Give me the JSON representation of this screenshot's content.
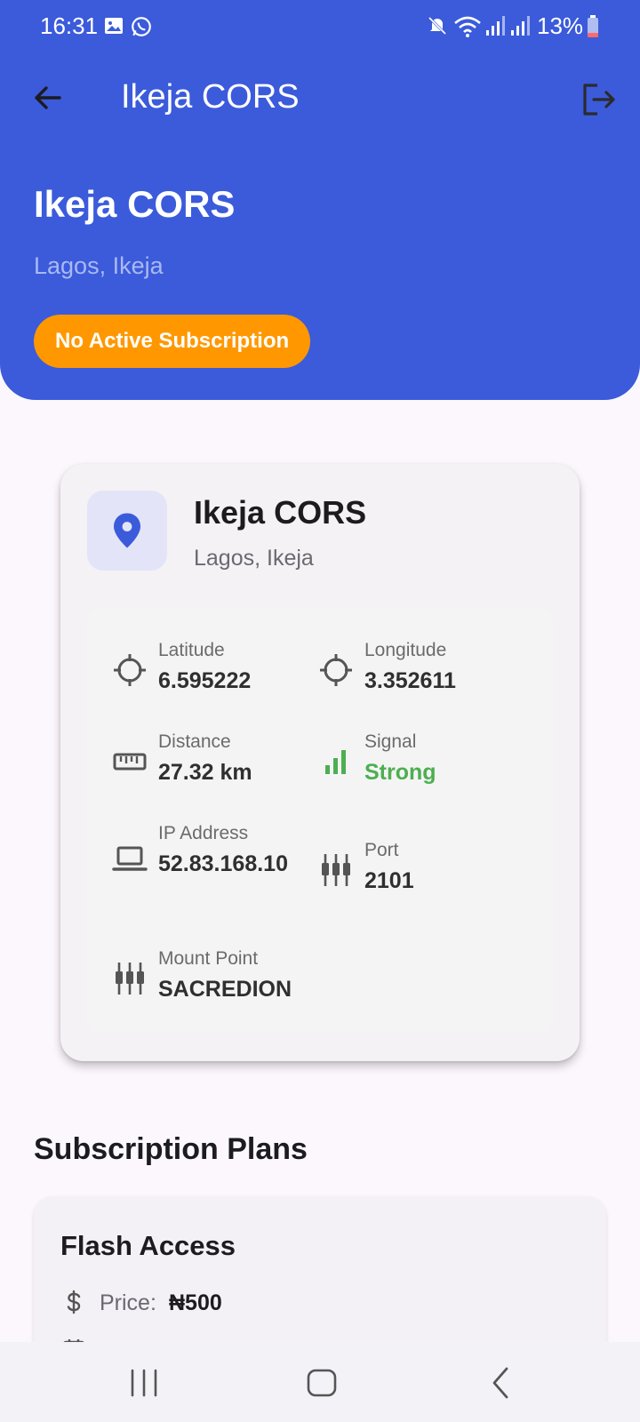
{
  "status_bar": {
    "time": "16:31",
    "battery": "13%",
    "icons": [
      "gallery-icon",
      "whatsapp-icon",
      "mute-icon",
      "wifi-icon",
      "signal-icon",
      "signal-icon",
      "battery-icon"
    ]
  },
  "app_bar": {
    "title": "Ikeja CORS",
    "back_icon": "arrow-left-icon",
    "logout_icon": "logout-icon"
  },
  "hero": {
    "title": "Ikeja CORS",
    "subtitle": "Lagos, Ikeja",
    "badge": "No Active Subscription"
  },
  "station": {
    "name": "Ikeja CORS",
    "location": "Lagos, Ikeja",
    "icon": "location-pin-icon",
    "details": [
      {
        "label": "Latitude",
        "value": "6.595222",
        "icon": "crosshair-icon"
      },
      {
        "label": "Longitude",
        "value": "3.352611",
        "icon": "crosshair-icon"
      },
      {
        "label": "Distance",
        "value": "27.32 km",
        "icon": "ruler-icon"
      },
      {
        "label": "Signal",
        "value": "Strong",
        "icon": "signal-bars-icon"
      },
      {
        "label": "IP Address",
        "value": "52.83.168.10",
        "icon": "laptop-icon"
      },
      {
        "label": "Port",
        "value": "2101",
        "icon": "port-icon"
      },
      {
        "label": "Mount Point",
        "value": "SACREDION",
        "icon": "port-icon"
      }
    ]
  },
  "plans": {
    "heading": "Subscription Plans",
    "items": [
      {
        "name": "Flash Access",
        "price_label": "Price:",
        "price_value": "₦500"
      }
    ]
  },
  "colors": {
    "header_bg": "#3b5bdb",
    "badge_bg": "#ff9800",
    "signal_strong": "#4caf50",
    "page_bg": "#fcf7fd"
  }
}
